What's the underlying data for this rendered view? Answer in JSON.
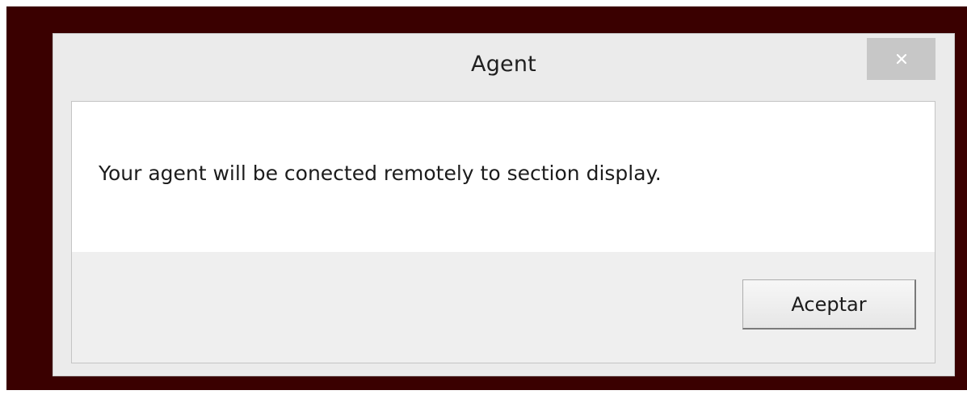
{
  "dialog": {
    "title": "Agent",
    "message": "Your agent will be conected remotely to section display.",
    "ok_label": "Aceptar"
  },
  "icons": {
    "close": "close-icon"
  },
  "colors": {
    "backdrop": "#3a0000",
    "dialog_chrome": "#ebebeb",
    "close_button": "#c7c7c7",
    "message_area": "#ffffff",
    "button_area": "#efefef"
  }
}
